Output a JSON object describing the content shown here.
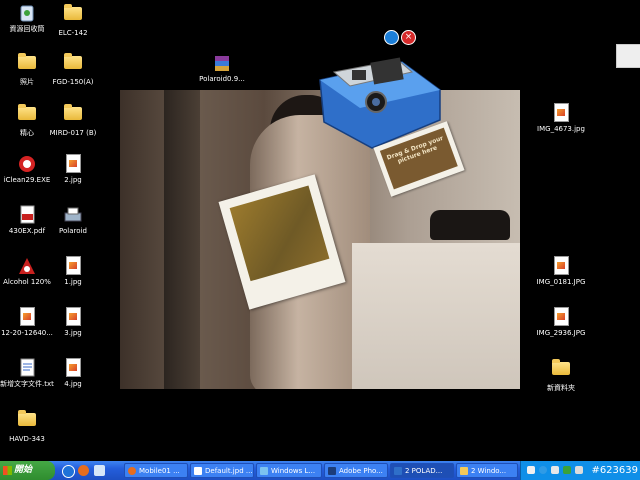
{
  "desktop": {
    "icons": [
      {
        "label": "資源回收筒",
        "icon": "recycle-bin-icon"
      },
      {
        "label": "ELC-142",
        "icon": "folder-icon"
      },
      {
        "label": "照片",
        "icon": "folder-icon"
      },
      {
        "label": "FGD-150(A)",
        "icon": "folder-icon"
      },
      {
        "label": "Polaroid0.9...",
        "icon": "winrar-icon"
      },
      {
        "label": "精心",
        "icon": "folder-icon"
      },
      {
        "label": "MIRD-017 (B)",
        "icon": "folder-icon"
      },
      {
        "label": "iClean29.EXE",
        "icon": "iclean-icon"
      },
      {
        "label": "2.jpg",
        "icon": "image-file-icon"
      },
      {
        "label": "430EX.pdf",
        "icon": "pdf-icon"
      },
      {
        "label": "Polaroid",
        "icon": "printer-icon"
      },
      {
        "label": "Alcohol 120%",
        "icon": "alcohol-icon"
      },
      {
        "label": "1.jpg",
        "icon": "image-file-icon"
      },
      {
        "label": "12-20-12640...",
        "icon": "image-file-icon"
      },
      {
        "label": "3.jpg",
        "icon": "image-file-icon"
      },
      {
        "label": "新增文字文件.txt",
        "icon": "text-file-icon"
      },
      {
        "label": "4.jpg",
        "icon": "image-file-icon"
      },
      {
        "label": "HAVD-343",
        "icon": "folder-icon"
      },
      {
        "label": "IMG_4673.jpg",
        "icon": "image-file-icon"
      },
      {
        "label": "IMG_0181.JPG",
        "icon": "image-file-icon"
      },
      {
        "label": "IMG_2936.JPG",
        "icon": "image-file-icon"
      },
      {
        "label": "新資料夾",
        "icon": "folder-icon"
      }
    ]
  },
  "polaroid_app": {
    "drop_text": "Drag & Drop your picture here",
    "minimize_icon": "minimize-icon",
    "close_icon": "close-icon"
  },
  "taskbar": {
    "start_label": "開始",
    "tasks": [
      {
        "label": "Mobile01 ...",
        "icon": "firefox-icon"
      },
      {
        "label": "Default.jpd ...",
        "icon": "window-icon"
      },
      {
        "label": "Windows L...",
        "icon": "window-icon"
      },
      {
        "label": "Adobe Pho...",
        "icon": "photoshop-icon"
      },
      {
        "label": "2 POLAD...",
        "icon": "polaroid-icon"
      },
      {
        "label": "2 Windo...",
        "icon": "folder-icon"
      }
    ],
    "clock": "#623639"
  },
  "colors": {
    "taskbar": "#245edb",
    "start": "#3a9a3a",
    "tray": "#0f8fe8"
  }
}
